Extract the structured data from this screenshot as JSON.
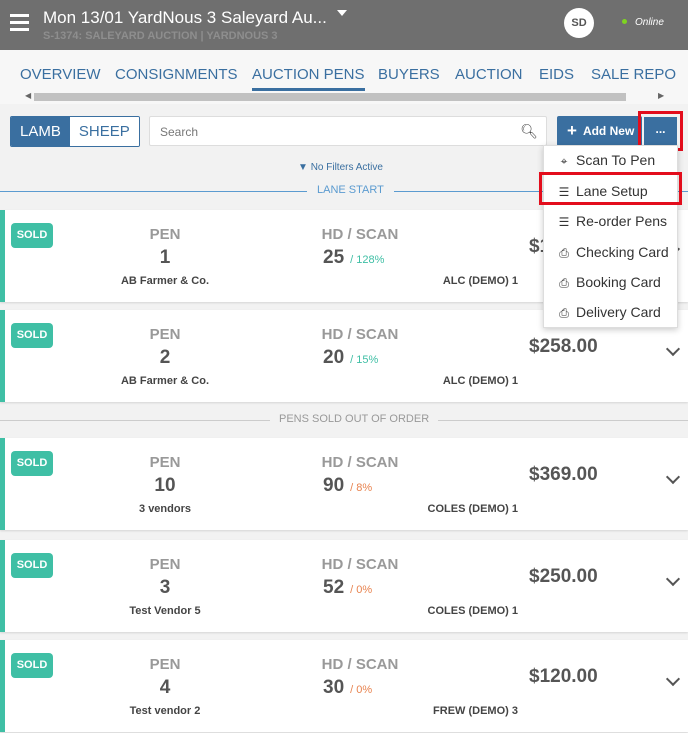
{
  "header": {
    "title": "Mon 13/01 YardNous 3 Saleyard Au...",
    "subtitle": "S-1374: SALEYARD AUCTION | YARDNOUS 3",
    "avatar": "SD",
    "status": "Online"
  },
  "tabs": [
    "OVERVIEW",
    "CONSIGNMENTS",
    "AUCTION PENS",
    "BUYERS",
    "AUCTION",
    "EIDS",
    "SALE REPO"
  ],
  "active_tab": "AUCTION PENS",
  "toolbar": {
    "lamb": "LAMB",
    "sheep": "SHEEP",
    "search_placeholder": "Search",
    "add_new": "Add New",
    "more": "...",
    "filters": "No Filters Active"
  },
  "menu": [
    "Scan To Pen",
    "Lane Setup",
    "Re-order Pens",
    "Checking Card",
    "Booking Card",
    "Delivery Card"
  ],
  "lane_start": "LANE START",
  "out_of_order": "PENS SOLD OUT OF ORDER",
  "labels": {
    "sold": "SOLD",
    "pen": "PEN",
    "hd": "HD / SCAN"
  },
  "colors": {
    "accent": "#3a6fa0",
    "sold": "#3fbfa5",
    "highlight": "#e30d1c",
    "pct_good": "#3fbfa5",
    "pct_low": "#e8834f"
  },
  "pens": [
    {
      "pen": "1",
      "vendor": "AB Farmer & Co.",
      "hd": "25",
      "pct": "/ 128%",
      "buyer": "ALC (DEMO)  1",
      "price": "$1"
    },
    {
      "pen": "2",
      "vendor": "AB Farmer & Co.",
      "hd": "20",
      "pct": "/ 15%",
      "buyer": "ALC (DEMO)  1",
      "price": "$258.00"
    },
    {
      "pen": "10",
      "vendor": "3 vendors",
      "hd": "90",
      "pct": "/ 8%",
      "buyer": "COLES (DEMO)  1",
      "price": "$369.00"
    },
    {
      "pen": "3",
      "vendor": "Test Vendor 5",
      "hd": "52",
      "pct": "/ 0%",
      "buyer": "COLES (DEMO)  1",
      "price": "$250.00"
    },
    {
      "pen": "4",
      "vendor": "Test vendor 2",
      "hd": "30",
      "pct": "/ 0%",
      "buyer": "FREW (DEMO)  3",
      "price": "$120.00"
    }
  ]
}
